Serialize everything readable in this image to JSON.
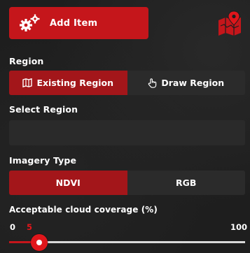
{
  "toolbar": {
    "add_item_label": "Add Item",
    "add_icon": "gears-icon",
    "map_icon": "map-pin-icon"
  },
  "region": {
    "label": "Region",
    "options": [
      {
        "label": "Existing Region",
        "icon": "map-icon",
        "active": true
      },
      {
        "label": "Draw Region",
        "icon": "pointer-hand-icon",
        "active": false
      }
    ]
  },
  "select_region": {
    "label": "Select Region",
    "value": ""
  },
  "imagery": {
    "label": "Imagery Type",
    "options": [
      {
        "label": "NDVI",
        "active": true
      },
      {
        "label": "RGB",
        "active": false
      }
    ]
  },
  "cloud": {
    "label": "Acceptable cloud coverage (%)",
    "min": "0",
    "max": "100",
    "value": "5"
  },
  "colors": {
    "accent": "#c5161b",
    "active_toggle": "#a3161a",
    "background": "#1e1e1e"
  }
}
